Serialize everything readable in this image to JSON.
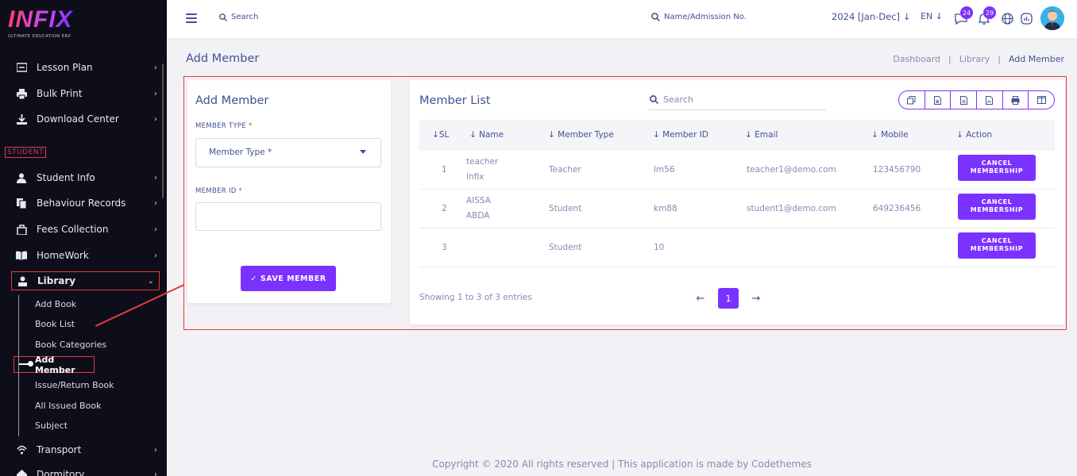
{
  "brand": {
    "logo": "INFIX",
    "tagline": "ULTIMATE EDUCATION ERP"
  },
  "sidebar": {
    "items_top": [
      {
        "label": "Lesson Plan",
        "icon": "list-icon"
      },
      {
        "label": "Bulk Print",
        "icon": "printer-icon"
      },
      {
        "label": "Download Center",
        "icon": "download-icon"
      }
    ],
    "section": "STUDENT",
    "items_student": [
      {
        "label": "Student Info",
        "icon": "user-icon"
      },
      {
        "label": "Behaviour Records",
        "icon": "records-icon"
      },
      {
        "label": "Fees Collection",
        "icon": "fees-icon"
      },
      {
        "label": "HomeWork",
        "icon": "book-icon"
      },
      {
        "label": "Library",
        "icon": "library-icon"
      }
    ],
    "library_sub": [
      "Add Book",
      "Book List",
      "Book Categories",
      "Add Member",
      "Issue/Return Book",
      "All Issued Book",
      "Subject"
    ],
    "items_bottom": [
      {
        "label": "Transport",
        "icon": "transport-icon"
      },
      {
        "label": "Dormitory",
        "icon": "dormitory-icon"
      }
    ]
  },
  "header": {
    "search_label": "Search",
    "student_search_label": "Name/Admission No.",
    "academic_year": "2024 [Jan-Dec]",
    "language": "EN",
    "messages_count": "24",
    "notifications_count": "29"
  },
  "page": {
    "title": "Add Member",
    "breadcrumb": [
      "Dashboard",
      "Library",
      "Add Member"
    ]
  },
  "form": {
    "title": "Add Member",
    "member_type_label": "MEMBER TYPE",
    "member_type_placeholder": "Member Type *",
    "member_id_label": "MEMBER ID",
    "required_mark": "*",
    "save_button": "SAVE MEMBER"
  },
  "member_list": {
    "title": "Member List",
    "search_placeholder": "Search",
    "export_buttons": [
      "copy-icon",
      "excel-icon",
      "csv-icon",
      "pdf-icon",
      "print-icon",
      "columns-icon"
    ],
    "columns": [
      "SL",
      "Name",
      "Member Type",
      "Member ID",
      "Email",
      "Mobile",
      "Action"
    ],
    "rows": [
      {
        "sl": "1",
        "name_line1": "teacher",
        "name_line2": "infix",
        "type": "Teacher",
        "member_id": "lm56",
        "email": "teacher1@demo.com",
        "mobile": "123456790",
        "action_line1": "CANCEL",
        "action_line2": "MEMBERSHIP"
      },
      {
        "sl": "2",
        "name_line1": "AISSA",
        "name_line2": "ABDA",
        "type": "Student",
        "member_id": "km88",
        "email": "student1@demo.com",
        "mobile": "649236456",
        "action_line1": "CANCEL",
        "action_line2": "MEMBERSHIP"
      },
      {
        "sl": "3",
        "name_line1": "",
        "name_line2": "",
        "type": "Student",
        "member_id": "10",
        "email": "",
        "mobile": "",
        "action_line1": "CANCEL",
        "action_line2": "MEMBERSHIP"
      }
    ],
    "showing_text": "Showing 1 to 3 of 3 entries",
    "current_page": "1"
  },
  "footer": "Copyright © 2020 All rights reserved | This application is made by Codethemes",
  "colors": {
    "accent": "#7c32ff",
    "highlight": "#e53a3a",
    "sidebar_bg": "#0e0e1a",
    "text": "#415094"
  }
}
